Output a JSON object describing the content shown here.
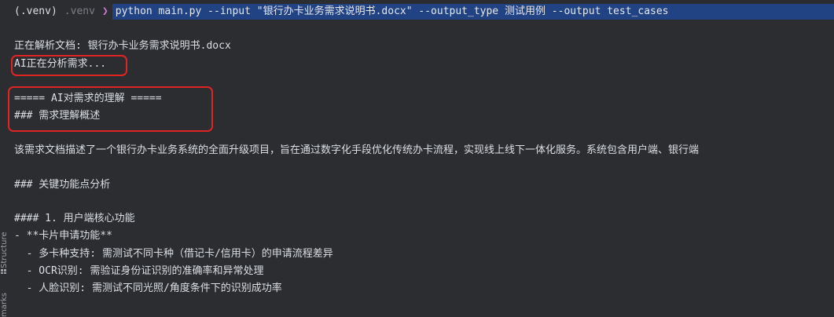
{
  "sidebar": {
    "structure_label": "Structure",
    "bookmarks_label": "marks"
  },
  "prompt": {
    "venv": "(.venv)",
    "venv_dir": ".venv",
    "arrow": "❯",
    "command": "python main.py --input \"银行办卡业务需求说明书.docx\" --output_type 测试用例 --output test_cases"
  },
  "output": {
    "parsing": "正在解析文档: 银行办卡业务需求说明书.docx",
    "analyzing": "AI正在分析需求...",
    "understanding_header": "===== AI对需求的理解 =====",
    "overview_heading": "### 需求理解概述",
    "summary": "该需求文档描述了一个银行办卡业务系统的全面升级项目，旨在通过数字化手段优化传统办卡流程，实现线上线下一体化服务。系统包含用户端、银行端",
    "key_points_heading": "### 关键功能点分析",
    "section1_heading": "#### 1. 用户端核心功能",
    "card_apply": "- **卡片申请功能**",
    "bullet_multi_card": "  - 多卡种支持: 需测试不同卡种（借记卡/信用卡）的申请流程差异",
    "bullet_ocr": "  - OCR识别: 需验证身份证识别的准确率和异常处理",
    "bullet_face": "  - 人脸识别: 需测试不同光照/角度条件下的识别成功率"
  },
  "colors": {
    "background": "#2b2d30",
    "text": "#dcdfe4",
    "selection": "#214283",
    "annotation": "#e02424",
    "prompt_arrow": "#cc7ad6"
  }
}
